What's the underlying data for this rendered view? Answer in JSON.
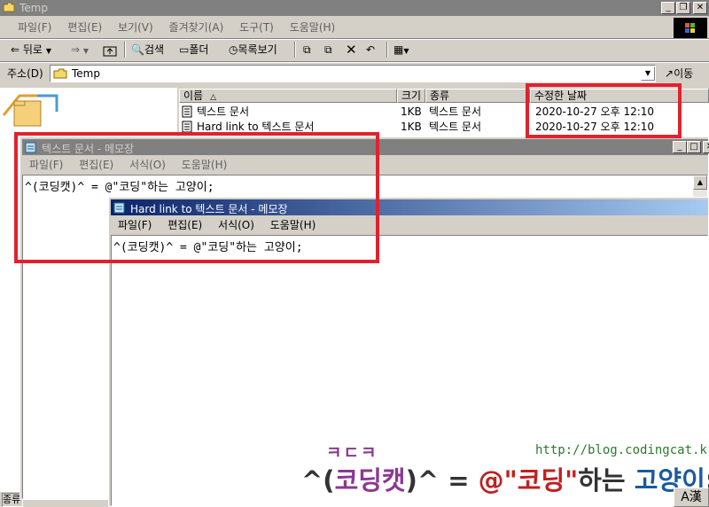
{
  "explorer": {
    "title": "Temp",
    "menu": [
      "파일(F)",
      "편집(E)",
      "보기(V)",
      "즐겨찾기(A)",
      "도구(T)",
      "도움말(H)"
    ],
    "toolbar": {
      "back": "뒤로",
      "search": "검색",
      "folders": "폴더",
      "history": "목록보기"
    },
    "address_label": "주소(D)",
    "address_value": "Temp",
    "go_label": "이동",
    "columns": [
      "이름",
      "크기",
      "종류",
      "수정한 날짜"
    ],
    "files": [
      {
        "name": "텍스트 문서",
        "size": "1KB",
        "type": "텍스트 문서",
        "modified": "2020-10-27 오후 12:10"
      },
      {
        "name": "Hard link to 텍스트 문서",
        "size": "1KB",
        "type": "텍스트 문서",
        "modified": "2020-10-27 오후 12:10"
      }
    ],
    "status_left": "종류"
  },
  "notepad1": {
    "title": "텍스트 문서 - 메모장",
    "menu": [
      "파일(F)",
      "편집(E)",
      "서식(O)",
      "도움말(H)"
    ],
    "content": "^(코딩캣)^ = @\"코딩\"하는 고양이;"
  },
  "notepad2": {
    "title": "Hard link to 텍스트 문서 - 메모장",
    "menu": [
      "파일(F)",
      "편집(E)",
      "서식(O)",
      "도움말(H)"
    ],
    "content": "^(코딩캣)^ = @\"코딩\"하는 고양이;"
  },
  "watermark": {
    "url": "http://blog.codingcat.kr/",
    "logo_small": "ㅋㄷㅋ",
    "part1": "^(",
    "part2": "코딩캣",
    "part3": ")^ = ",
    "part4": "@\"코딩\"",
    "part5": "하는 ",
    "part6": "고양이",
    "part7": ";"
  },
  "ime_label": "A漢",
  "colors": {
    "highlight": "#e0222f",
    "title_active": "#0a246a",
    "title_inactive": "#808080"
  }
}
